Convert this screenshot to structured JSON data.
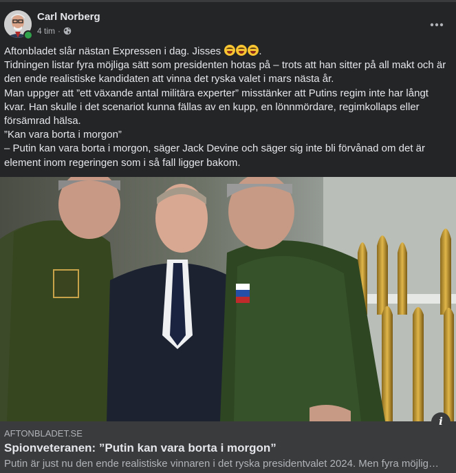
{
  "post": {
    "author": "Carl Norberg",
    "time": "4 tim",
    "separator": "·",
    "privacy_icon": "globe-icon",
    "more_icon": "more-horizontal-icon",
    "text": {
      "line1": "Aftonbladet slår nästan Expressen i dag. Jisses",
      "line1_suffix": ".",
      "line2": "Tidningen listar fyra möjliga sätt som presidenten hotas på – trots att han sitter på all makt och är den ende realistiske kandidaten att vinna det ryska valet i mars nästa år.",
      "line3": "Man uppger att ”ett växande antal militära experter” misstänker att Putins regim inte har långt kvar. Han skulle i det scenariot kunna fällas av en kupp, en lönnmördare, regimkollaps eller försämrad hälsa.",
      "line4": "”Kan vara borta i morgon”",
      "line5": "–  Putin kan vara borta i morgon, säger Jack Devine och säger sig inte bli förvånad om det är element inom regeringen som i så fall ligger bakom."
    },
    "emoji_count": 3,
    "emoji_icon": "rolling-on-floor-laughing-emoji"
  },
  "link_preview": {
    "domain": "AFTONBLADET.SE",
    "title": "Spionveteranen: ”Putin kan vara borta i morgon”",
    "description": "Putin är just nu den ende realistiske vinnaren i det ryska presidentvalet 2024. Men fyra möjlig…",
    "info_icon": "info-icon"
  },
  "colors": {
    "background": "#242526",
    "text_primary": "#e4e6eb",
    "text_secondary": "#b0b3b8",
    "preview_bar": "#3a3b3c",
    "online": "#31a24c"
  }
}
